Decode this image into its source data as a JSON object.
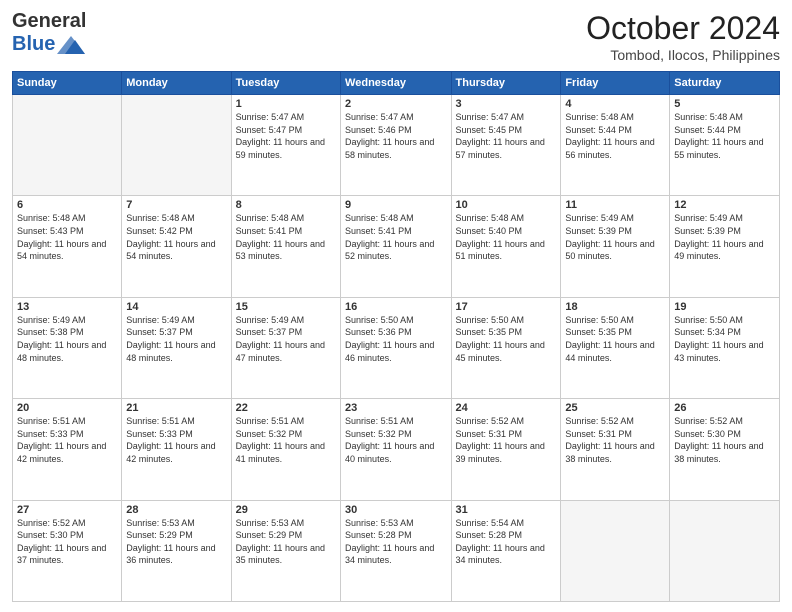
{
  "header": {
    "logo_general": "General",
    "logo_blue": "Blue",
    "month_title": "October 2024",
    "location": "Tombod, Ilocos, Philippines"
  },
  "weekdays": [
    "Sunday",
    "Monday",
    "Tuesday",
    "Wednesday",
    "Thursday",
    "Friday",
    "Saturday"
  ],
  "weeks": [
    [
      {
        "day": "",
        "empty": true
      },
      {
        "day": "",
        "empty": true
      },
      {
        "day": "1",
        "sunrise": "5:47 AM",
        "sunset": "5:47 PM",
        "daylight": "11 hours and 59 minutes."
      },
      {
        "day": "2",
        "sunrise": "5:47 AM",
        "sunset": "5:46 PM",
        "daylight": "11 hours and 58 minutes."
      },
      {
        "day": "3",
        "sunrise": "5:47 AM",
        "sunset": "5:45 PM",
        "daylight": "11 hours and 57 minutes."
      },
      {
        "day": "4",
        "sunrise": "5:48 AM",
        "sunset": "5:44 PM",
        "daylight": "11 hours and 56 minutes."
      },
      {
        "day": "5",
        "sunrise": "5:48 AM",
        "sunset": "5:44 PM",
        "daylight": "11 hours and 55 minutes."
      }
    ],
    [
      {
        "day": "6",
        "sunrise": "5:48 AM",
        "sunset": "5:43 PM",
        "daylight": "11 hours and 54 minutes."
      },
      {
        "day": "7",
        "sunrise": "5:48 AM",
        "sunset": "5:42 PM",
        "daylight": "11 hours and 54 minutes."
      },
      {
        "day": "8",
        "sunrise": "5:48 AM",
        "sunset": "5:41 PM",
        "daylight": "11 hours and 53 minutes."
      },
      {
        "day": "9",
        "sunrise": "5:48 AM",
        "sunset": "5:41 PM",
        "daylight": "11 hours and 52 minutes."
      },
      {
        "day": "10",
        "sunrise": "5:48 AM",
        "sunset": "5:40 PM",
        "daylight": "11 hours and 51 minutes."
      },
      {
        "day": "11",
        "sunrise": "5:49 AM",
        "sunset": "5:39 PM",
        "daylight": "11 hours and 50 minutes."
      },
      {
        "day": "12",
        "sunrise": "5:49 AM",
        "sunset": "5:39 PM",
        "daylight": "11 hours and 49 minutes."
      }
    ],
    [
      {
        "day": "13",
        "sunrise": "5:49 AM",
        "sunset": "5:38 PM",
        "daylight": "11 hours and 48 minutes."
      },
      {
        "day": "14",
        "sunrise": "5:49 AM",
        "sunset": "5:37 PM",
        "daylight": "11 hours and 48 minutes."
      },
      {
        "day": "15",
        "sunrise": "5:49 AM",
        "sunset": "5:37 PM",
        "daylight": "11 hours and 47 minutes."
      },
      {
        "day": "16",
        "sunrise": "5:50 AM",
        "sunset": "5:36 PM",
        "daylight": "11 hours and 46 minutes."
      },
      {
        "day": "17",
        "sunrise": "5:50 AM",
        "sunset": "5:35 PM",
        "daylight": "11 hours and 45 minutes."
      },
      {
        "day": "18",
        "sunrise": "5:50 AM",
        "sunset": "5:35 PM",
        "daylight": "11 hours and 44 minutes."
      },
      {
        "day": "19",
        "sunrise": "5:50 AM",
        "sunset": "5:34 PM",
        "daylight": "11 hours and 43 minutes."
      }
    ],
    [
      {
        "day": "20",
        "sunrise": "5:51 AM",
        "sunset": "5:33 PM",
        "daylight": "11 hours and 42 minutes."
      },
      {
        "day": "21",
        "sunrise": "5:51 AM",
        "sunset": "5:33 PM",
        "daylight": "11 hours and 42 minutes."
      },
      {
        "day": "22",
        "sunrise": "5:51 AM",
        "sunset": "5:32 PM",
        "daylight": "11 hours and 41 minutes."
      },
      {
        "day": "23",
        "sunrise": "5:51 AM",
        "sunset": "5:32 PM",
        "daylight": "11 hours and 40 minutes."
      },
      {
        "day": "24",
        "sunrise": "5:52 AM",
        "sunset": "5:31 PM",
        "daylight": "11 hours and 39 minutes."
      },
      {
        "day": "25",
        "sunrise": "5:52 AM",
        "sunset": "5:31 PM",
        "daylight": "11 hours and 38 minutes."
      },
      {
        "day": "26",
        "sunrise": "5:52 AM",
        "sunset": "5:30 PM",
        "daylight": "11 hours and 38 minutes."
      }
    ],
    [
      {
        "day": "27",
        "sunrise": "5:52 AM",
        "sunset": "5:30 PM",
        "daylight": "11 hours and 37 minutes."
      },
      {
        "day": "28",
        "sunrise": "5:53 AM",
        "sunset": "5:29 PM",
        "daylight": "11 hours and 36 minutes."
      },
      {
        "day": "29",
        "sunrise": "5:53 AM",
        "sunset": "5:29 PM",
        "daylight": "11 hours and 35 minutes."
      },
      {
        "day": "30",
        "sunrise": "5:53 AM",
        "sunset": "5:28 PM",
        "daylight": "11 hours and 34 minutes."
      },
      {
        "day": "31",
        "sunrise": "5:54 AM",
        "sunset": "5:28 PM",
        "daylight": "11 hours and 34 minutes."
      },
      {
        "day": "",
        "empty": true
      },
      {
        "day": "",
        "empty": true
      }
    ]
  ]
}
